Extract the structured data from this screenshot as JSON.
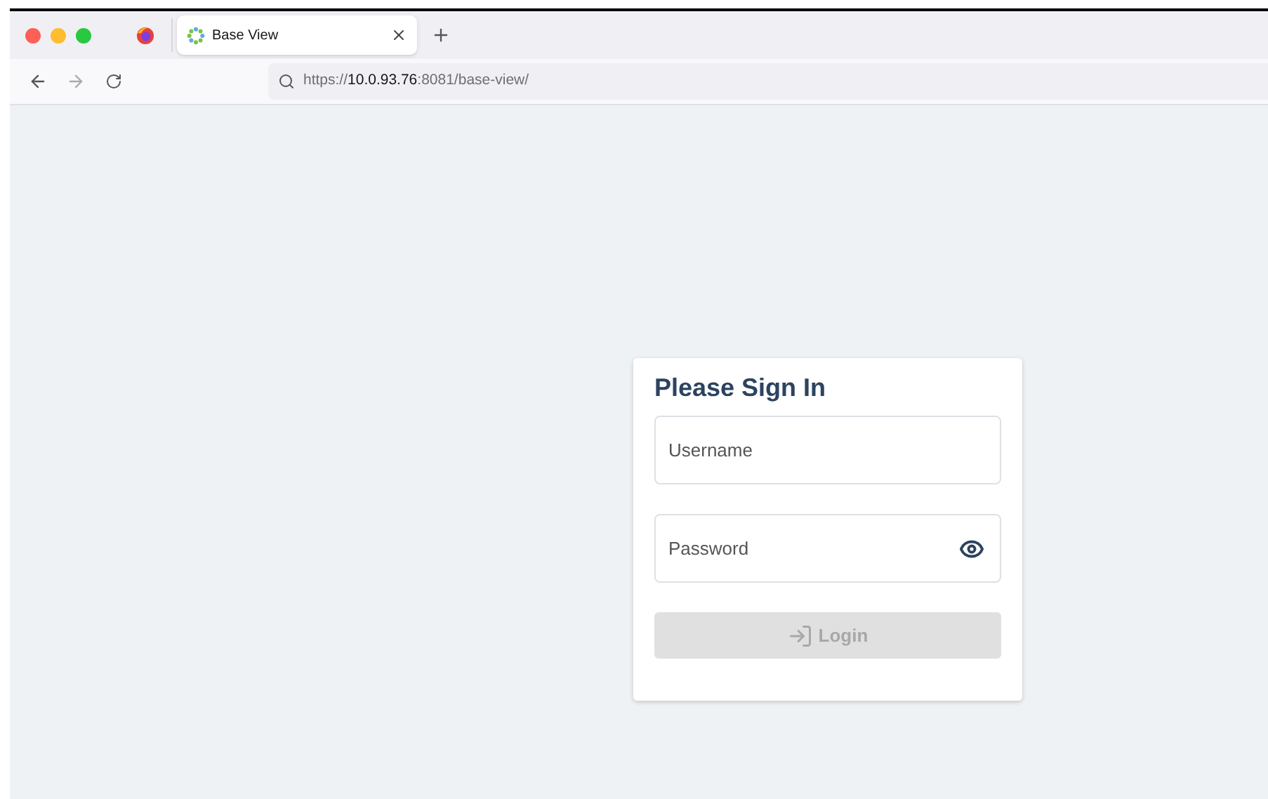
{
  "browser": {
    "tab": {
      "title": "Base View",
      "selected": true
    },
    "url": {
      "scheme": "https://",
      "host": "10.0.93.76",
      "rest": ":8081/base-view/"
    }
  },
  "login_card": {
    "title": "Please Sign In",
    "username": {
      "placeholder": "Username"
    },
    "password": {
      "placeholder": "Password"
    },
    "login_button": {
      "label": "Login",
      "disabled": true
    }
  }
}
